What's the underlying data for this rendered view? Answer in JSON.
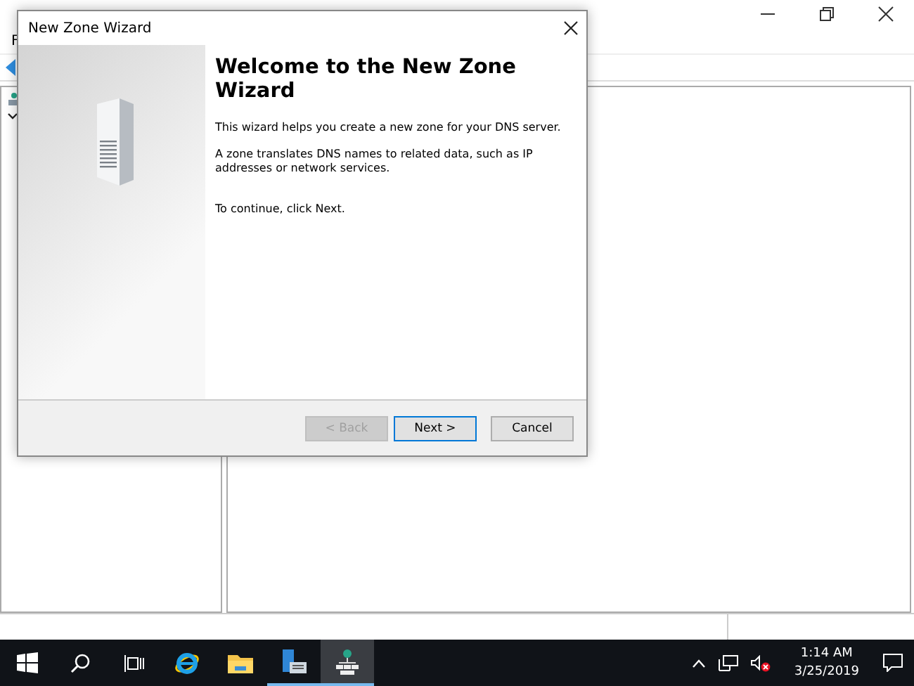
{
  "background_window": {
    "menu": [
      "F"
    ]
  },
  "dialog": {
    "title": "New Zone Wizard",
    "heading": "Welcome to the New Zone Wizard",
    "paragraphs": [
      "This wizard helps you create a new zone for your DNS server.",
      "A zone translates DNS names to related data, such as IP addresses or network services.",
      "To continue, click Next."
    ],
    "buttons": [
      {
        "label": "< Back",
        "disabled": true,
        "default": false
      },
      {
        "label": "Next >",
        "disabled": false,
        "default": true
      },
      {
        "label": "Cancel",
        "disabled": false,
        "default": false
      }
    ]
  },
  "taskbar": {
    "apps": [
      {
        "kind": "ie",
        "running": false,
        "selected": false
      },
      {
        "kind": "explorer",
        "running": false,
        "selected": false
      },
      {
        "kind": "server",
        "running": true,
        "selected": false
      },
      {
        "kind": "dns",
        "running": true,
        "selected": true
      }
    ],
    "time": "1:14 AM",
    "date": "3/25/2019"
  }
}
